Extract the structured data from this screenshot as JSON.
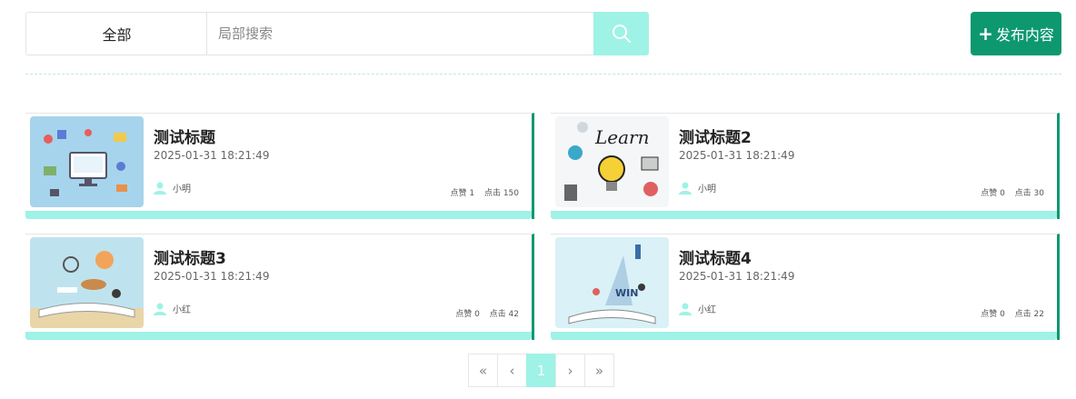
{
  "filter": {
    "category": "全部",
    "search_placeholder": "局部搜索",
    "publish_label": "发布内容"
  },
  "colors": {
    "accent": "#0e9870",
    "light_accent": "#9ff2e6"
  },
  "posts": [
    {
      "title": "测试标题",
      "date": "2025-01-31 18:21:49",
      "author": "小明",
      "likes": "点赞 1",
      "clicks": "点击 150",
      "image": "tech-illustration"
    },
    {
      "title": "测试标题2",
      "date": "2025-01-31 18:21:49",
      "author": "小明",
      "likes": "点赞 0",
      "clicks": "点击 30",
      "image": "learn-lightbulb"
    },
    {
      "title": "测试标题3",
      "date": "2025-01-31 18:21:49",
      "author": "小红",
      "likes": "点赞 0",
      "clicks": "点击 42",
      "image": "book-travel"
    },
    {
      "title": "测试标题4",
      "date": "2025-01-31 18:21:49",
      "author": "小红",
      "likes": "点赞 0",
      "clicks": "点击 22",
      "image": "book-rocket"
    }
  ],
  "pagination": {
    "first": "«",
    "prev": "‹",
    "current": "1",
    "next": "›",
    "last": "»"
  }
}
